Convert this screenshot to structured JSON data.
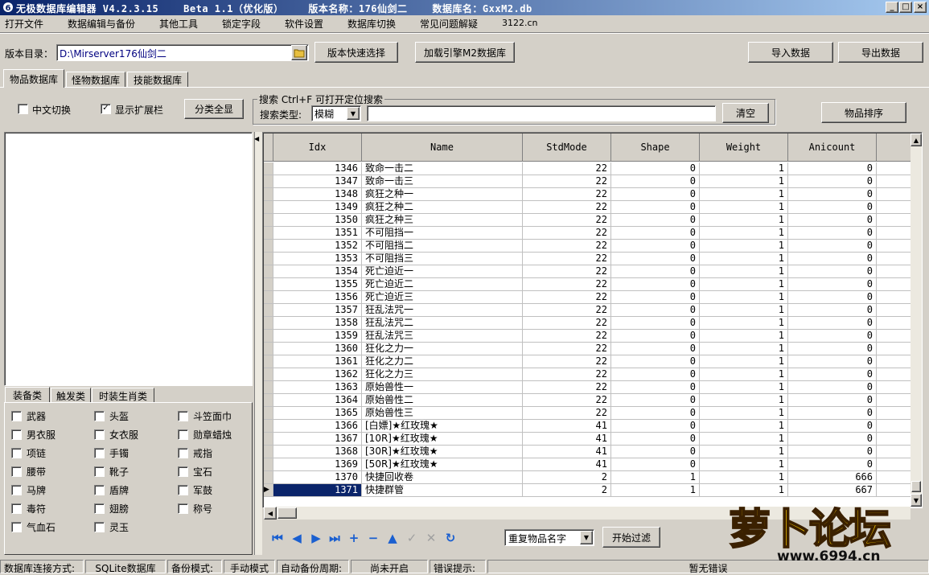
{
  "window": {
    "title": "无极数据库编辑器 V4.2.3.15    Beta 1.1（优化版）    版本名称：176仙剑二    数据库名：GxxM2.db",
    "controls": [
      "_",
      "□",
      "×"
    ]
  },
  "menu": [
    "打开文件",
    "数据编辑与备份",
    "其他工具",
    "锁定字段",
    "软件设置",
    "数据库切换",
    "常见问题解疑",
    "3122.cn"
  ],
  "toolbar": {
    "dir_label": "版本目录：",
    "dir_value": "D:\\Mirserver176仙剑二",
    "version_select_btn": "版本快速选择",
    "load_engine_btn": "加载引擎M2数据库",
    "import_btn": "导入数据",
    "export_btn": "导出数据"
  },
  "db_tabs": [
    "物品数据库",
    "怪物数据库",
    "技能数据库"
  ],
  "options": {
    "chinese_switch": "中文切换",
    "chinese_checked": false,
    "show_ext": "显示扩展栏",
    "show_ext_checked": true,
    "show_all_btn": "分类全显"
  },
  "search": {
    "group_title": "搜索   Ctrl+F  可打开定位搜索",
    "type_label": "搜索类型:",
    "type_value": "模糊",
    "query": "",
    "clear_btn": "清空"
  },
  "sort_btn": "物品排序",
  "category_tabs": [
    "装备类",
    "触发类",
    "时装生肖类"
  ],
  "categories": [
    [
      "武器",
      "头盔",
      "斗笠面巾"
    ],
    [
      "男衣服",
      "女衣服",
      "勋章蜡烛"
    ],
    [
      "项链",
      "手镯",
      "戒指"
    ],
    [
      "腰带",
      "靴子",
      "宝石"
    ],
    [
      "马牌",
      "盾牌",
      "军鼓"
    ],
    [
      "毒符",
      "翅膀",
      "称号"
    ],
    [
      "气血石",
      "灵玉"
    ]
  ],
  "grid": {
    "columns": [
      "Idx",
      "Name",
      "StdMode",
      "Shape",
      "Weight",
      "Anicount",
      "S"
    ],
    "rows": [
      [
        "1346",
        "致命一击二",
        "22",
        "0",
        "1",
        "0"
      ],
      [
        "1347",
        "致命一击三",
        "22",
        "0",
        "1",
        "0"
      ],
      [
        "1348",
        "疯狂之种一",
        "22",
        "0",
        "1",
        "0"
      ],
      [
        "1349",
        "疯狂之种二",
        "22",
        "0",
        "1",
        "0"
      ],
      [
        "1350",
        "疯狂之种三",
        "22",
        "0",
        "1",
        "0"
      ],
      [
        "1351",
        "不可阻挡一",
        "22",
        "0",
        "1",
        "0"
      ],
      [
        "1352",
        "不可阻挡二",
        "22",
        "0",
        "1",
        "0"
      ],
      [
        "1353",
        "不可阻挡三",
        "22",
        "0",
        "1",
        "0"
      ],
      [
        "1354",
        "死亡迫近一",
        "22",
        "0",
        "1",
        "0"
      ],
      [
        "1355",
        "死亡迫近二",
        "22",
        "0",
        "1",
        "0"
      ],
      [
        "1356",
        "死亡迫近三",
        "22",
        "0",
        "1",
        "0"
      ],
      [
        "1357",
        "狂乱法咒一",
        "22",
        "0",
        "1",
        "0"
      ],
      [
        "1358",
        "狂乱法咒二",
        "22",
        "0",
        "1",
        "0"
      ],
      [
        "1359",
        "狂乱法咒三",
        "22",
        "0",
        "1",
        "0"
      ],
      [
        "1360",
        "狂化之力一",
        "22",
        "0",
        "1",
        "0"
      ],
      [
        "1361",
        "狂化之力二",
        "22",
        "0",
        "1",
        "0"
      ],
      [
        "1362",
        "狂化之力三",
        "22",
        "0",
        "1",
        "0"
      ],
      [
        "1363",
        "原始兽性一",
        "22",
        "0",
        "1",
        "0"
      ],
      [
        "1364",
        "原始兽性二",
        "22",
        "0",
        "1",
        "0"
      ],
      [
        "1365",
        "原始兽性三",
        "22",
        "0",
        "1",
        "0"
      ],
      [
        "1366",
        "[白嫖]★红玫瑰★",
        "41",
        "0",
        "1",
        "0"
      ],
      [
        "1367",
        "[10R]★红玫瑰★",
        "41",
        "0",
        "1",
        "0"
      ],
      [
        "1368",
        "[30R]★红玫瑰★",
        "41",
        "0",
        "1",
        "0"
      ],
      [
        "1369",
        "[50R]★红玫瑰★",
        "41",
        "0",
        "1",
        "0"
      ],
      [
        "1370",
        "快捷回收卷",
        "2",
        "1",
        "1",
        "666"
      ],
      [
        "1371",
        "快捷群管",
        "2",
        "1",
        "1",
        "667"
      ]
    ],
    "selected_index": 25
  },
  "nav": {
    "icons": [
      "first-icon",
      "prev-icon",
      "next-icon",
      "last-icon",
      "plus-icon",
      "minus-icon",
      "up-icon",
      "check-icon",
      "cancel-icon",
      "refresh-icon"
    ],
    "filter_value": "重复物品名字",
    "filter_btn": "开始过滤"
  },
  "status": {
    "conn_label": "数据库连接方式:",
    "conn_value": "SQLite数据库",
    "backup_label": "备份模式:",
    "backup_value": "手动模式",
    "auto_label": "自动备份周期:",
    "auto_value": "尚未开启",
    "error_label": "错误提示:",
    "error_value": "暂无错误"
  },
  "watermark": {
    "brand": "萝卜论坛",
    "site": "www.6994.cn"
  }
}
